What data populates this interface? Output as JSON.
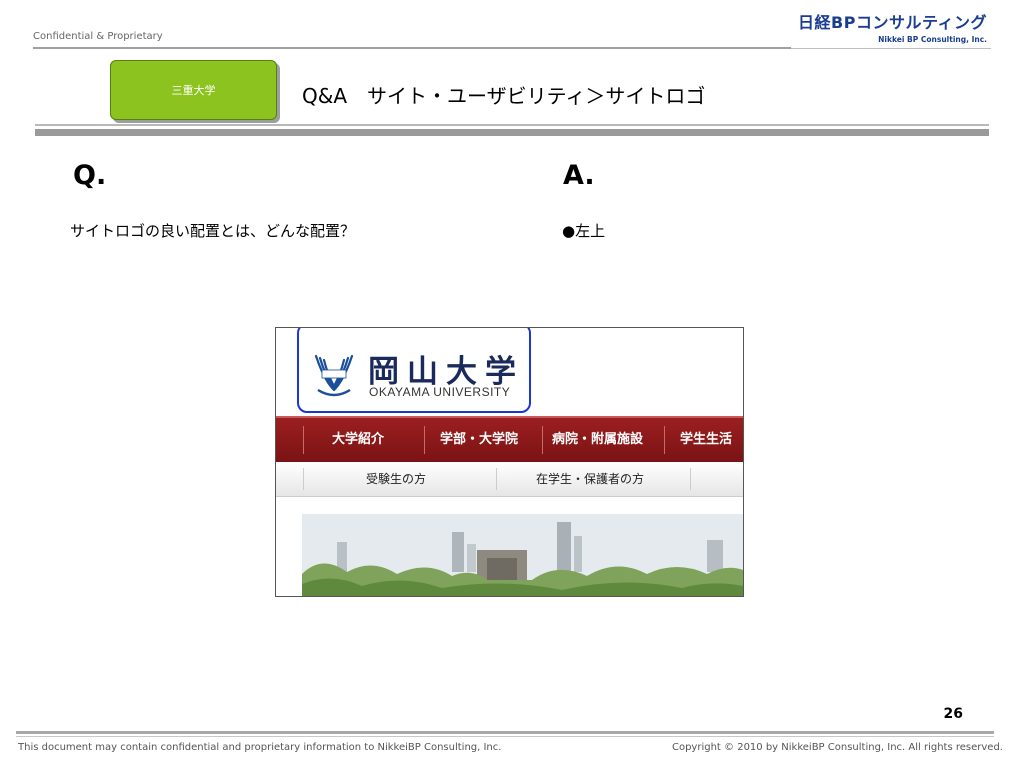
{
  "header": {
    "confidential": "Confidential & Proprietary",
    "brand_jp": "日経BPコンサルティング",
    "brand_en": "Nikkei BP Consulting, Inc."
  },
  "slide": {
    "badge": "三重大学",
    "title": "Q&A　サイト・ユーザビリティ＞サイトロゴ",
    "q_label": "Q.",
    "a_label": "A.",
    "question": "サイトロゴの良い配置とは、どんな配置？",
    "answer": "●左上",
    "page_number": "26"
  },
  "screenshot": {
    "logo_kanji": "岡山大学",
    "logo_en": "OKAYAMA UNIVERSITY",
    "nav_items": [
      "大学紹介",
      "学部・大学院",
      "病院・附属施設",
      "学生生活"
    ],
    "subnav_items": [
      "受験生の方",
      "在学生・保護者の方"
    ],
    "nav_color": "#8a1a1b",
    "highlight_color": "#1a35d8"
  },
  "footer": {
    "left": "This document may contain confidential and proprietary information to NikkeiBP Consulting, Inc.",
    "right": "Copyright © 2010 by NikkeiBP Consulting, Inc. All rights reserved."
  },
  "colors": {
    "badge": "#8cc31e",
    "brand": "#1a3d8f"
  }
}
